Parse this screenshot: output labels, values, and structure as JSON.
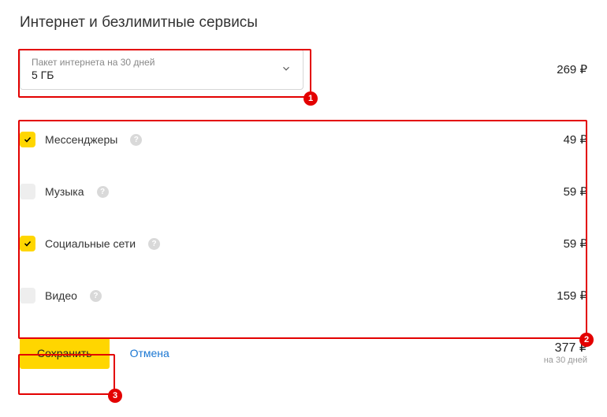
{
  "title": "Интернет и безлимитные сервисы",
  "package": {
    "label": "Пакет интернета на 30 дней",
    "value": "5 ГБ",
    "price": "269 ₽"
  },
  "services": [
    {
      "label": "Мессенджеры",
      "price": "49 ₽",
      "checked": true
    },
    {
      "label": "Музыка",
      "price": "59 ₽",
      "checked": false
    },
    {
      "label": "Социальные сети",
      "price": "59 ₽",
      "checked": true
    },
    {
      "label": "Видео",
      "price": "159 ₽",
      "checked": false
    }
  ],
  "footer": {
    "save": "Сохранить",
    "cancel": "Отмена",
    "total": "377 ₽",
    "period": "на 30 дней"
  },
  "annotations": {
    "b1": "1",
    "b2": "2",
    "b3": "3"
  }
}
